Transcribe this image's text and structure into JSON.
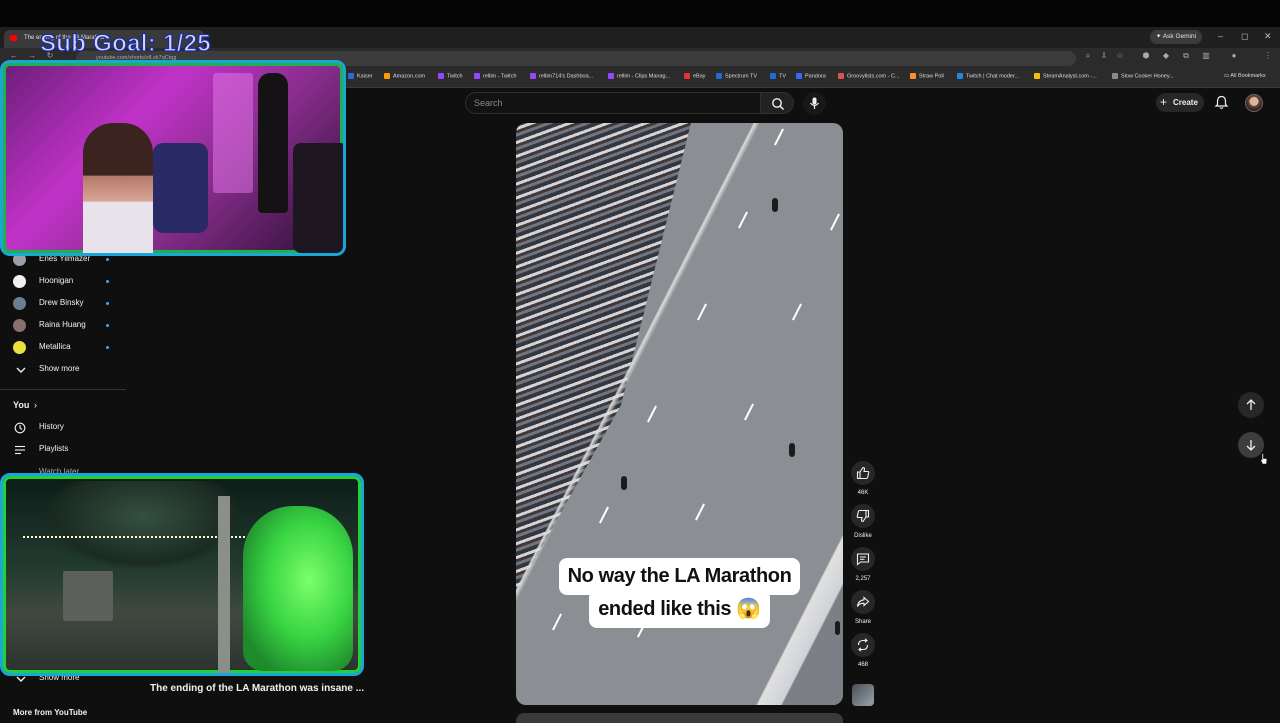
{
  "overlay": {
    "sub_goal": "Sub Goal: 1/25"
  },
  "browser": {
    "tab_title": "The ending of the LA Marathon...",
    "ask_gemini": "Ask Gemini",
    "url": "youtube.com/shorts/ofLxk7qCtqg",
    "bookmarks": [
      "Kaiser",
      "Amazon.com",
      "Twitch",
      "rellim - Twitch",
      "rellim714's Dashboa...",
      "rellim - Clips Manag...",
      "eBay",
      "Spectrum TV",
      "TV",
      "Pandora",
      "Groovylists.com - C...",
      "Straw Poll",
      "Twitch | Chat moder...",
      "SteamAnalyst.com -...",
      "Slow Cooker Honey..."
    ],
    "all_bookmarks": "All Bookmarks"
  },
  "header": {
    "search_placeholder": "Search",
    "create_label": "Create",
    "create_plus": "+"
  },
  "sidebar": {
    "subscriptions": [
      {
        "label": "Enes Yilmazer",
        "color": "#9aa0a6"
      },
      {
        "label": "Hoonigan",
        "color": "#f1f1f1"
      },
      {
        "label": "Drew Binsky",
        "color": "#6b7f93"
      },
      {
        "label": "Raina Huang",
        "color": "#8a6f6f"
      },
      {
        "label": "Metallica",
        "color": "#e8e23a"
      }
    ],
    "show_more": "Show more",
    "you": "You",
    "you_chevron": "›",
    "you_items": [
      "History",
      "Playlists"
    ],
    "watch_later": "Watch later",
    "show_more_2": "Show more",
    "more_from_youtube": "More from YouTube"
  },
  "video": {
    "caption_line1": "No way the LA Marathon",
    "caption_line2": "ended like this 😱",
    "title": "The ending of the LA Marathon was insane ..."
  },
  "actions": {
    "likes": "46K",
    "dislike": "Dislike",
    "comments": "2,257",
    "share": "Share",
    "remix": "468"
  },
  "colors": {
    "background": "#0f0f0f",
    "webcam_border": "#1aa7d8",
    "subgoal_text": "#cfd6ff"
  }
}
